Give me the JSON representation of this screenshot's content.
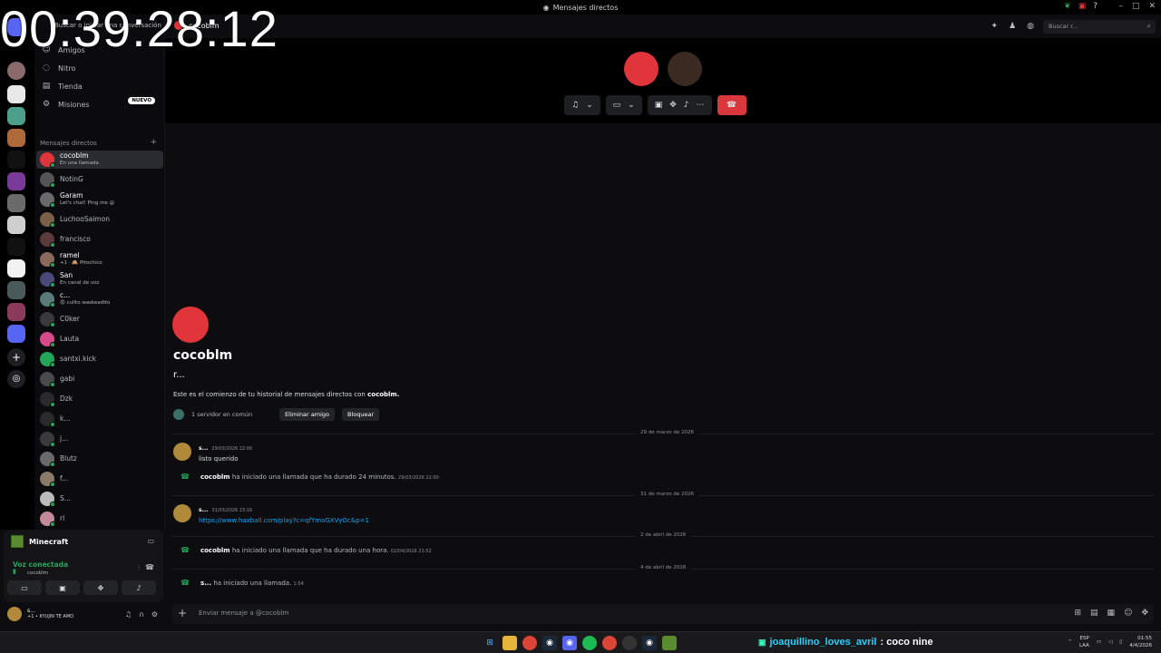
{
  "overlay": {
    "timer": "00:39:28:12"
  },
  "window": {
    "title": "Mensajes directos"
  },
  "sidebar": {
    "search_placeholder": "Buscar o iniciar una conversación",
    "nav": [
      {
        "label": "Amigos",
        "icon": "friends-icon"
      },
      {
        "label": "Nitro",
        "icon": "nitro-icon"
      },
      {
        "label": "Tienda",
        "icon": "shop-icon",
        "badge": "NUEVO"
      },
      {
        "label": "Misiones",
        "icon": "quests-icon"
      }
    ],
    "dm_header": "Mensajes directos",
    "dms": [
      {
        "name": "cocoblm",
        "sub": "En una llamada",
        "color": "#e0353b",
        "active": true
      },
      {
        "name": "NotinG",
        "sub": "",
        "color": "#555"
      },
      {
        "name": "Garam",
        "sub": "Let's chat! Ping me @",
        "color": "#6a6a6a"
      },
      {
        "name": "LuchooSaimon",
        "sub": "",
        "color": "#7a5f4a"
      },
      {
        "name": "francisco",
        "sub": "",
        "color": "#5a3a3a"
      },
      {
        "name": "ramel",
        "sub": "+1 · 🙈 Pitochico",
        "color": "#8a6a5a"
      },
      {
        "name": "San",
        "sub": "En canal de voz",
        "color": "#4a4a7a"
      },
      {
        "name": "c...",
        "sub": "😡 culito waskeadito",
        "color": "#5a7a7a"
      },
      {
        "name": "C0ker",
        "sub": "",
        "color": "#3a3a3a"
      },
      {
        "name": "Lauta",
        "sub": "",
        "color": "#d64a8a"
      },
      {
        "name": "santxi.kick",
        "sub": "",
        "color": "#23a55a"
      },
      {
        "name": "gabi",
        "sub": "",
        "color": "#4a4a4a"
      },
      {
        "name": "Dzk",
        "sub": "",
        "color": "#2a2a2a"
      },
      {
        "name": "k...",
        "sub": "",
        "color": "#2a2a2a"
      },
      {
        "name": "j...",
        "sub": "",
        "color": "#3a3a3a"
      },
      {
        "name": "Blutz",
        "sub": "",
        "color": "#6a6a6a"
      },
      {
        "name": "f...",
        "sub": "",
        "color": "#8a7a6a"
      },
      {
        "name": "S...",
        "sub": "",
        "color": "#bbbbbb"
      },
      {
        "name": "rl",
        "sub": "",
        "color": "#c2899a"
      },
      {
        "name": "fitch",
        "sub": "",
        "color": "#2a2a2a"
      }
    ]
  },
  "voice_panel": {
    "game": "Minecraft",
    "status": "Voz conectada",
    "channel": "cocoblm"
  },
  "user_bar": {
    "name": "s...",
    "status": "+1 • KYUJIN TE AMO"
  },
  "main": {
    "dm_title": "cocoblm",
    "search_placeholder": "Buscar r...",
    "intro": {
      "name": "cocoblm",
      "handle": "r...",
      "text_prefix": "Este es el comienzo de tu historial de mensajes directos con ",
      "text_name": "cocoblm.",
      "mutual": "1 servidor en común",
      "remove_friend": "Eliminar amigo",
      "block": "Bloquear"
    },
    "dividers": [
      "29 de marzo de 2026",
      "31 de marzo de 2026",
      "2 de abril de 2026",
      "4 de abril de 2026"
    ],
    "messages": [
      {
        "author": "s...",
        "time": "29/03/2026 22:00",
        "text": "listo querido"
      },
      {
        "author": "s...",
        "time": "31/03/2026 23:16",
        "text": "https://www.haxball.com/play?c=qfYmoGXVyOc&p=1"
      }
    ],
    "system": [
      {
        "who": "cocoblm",
        "text": " ha iniciado una llamada que ha durado 24 minutos.",
        "time": "29/03/2026 22:00"
      },
      {
        "who": "cocoblm",
        "text": " ha iniciado una llamada que ha durado una hora.",
        "time": "02/04/2026 21:52"
      },
      {
        "who": "s...",
        "text": " ha iniciado una llamada.",
        "time": "1:54"
      }
    ],
    "composer_placeholder": "Enviar mensaje a @cocoblm"
  },
  "taskbar": {
    "ticker_user": "joaquillino_loves_avril",
    "ticker_msg": ": coco nine",
    "lang": "ESP",
    "lang2": "LAA",
    "time": "01:55",
    "date": "4/4/2026"
  },
  "colors": {
    "accent": "#5865f2",
    "online": "#23a55a",
    "end_call": "#da373c",
    "link": "#00a8fc"
  }
}
